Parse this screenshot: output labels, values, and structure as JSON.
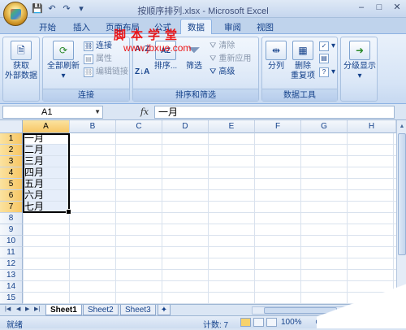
{
  "window": {
    "title": "按顺序排列.xlsx - Microsoft Excel",
    "qat": [
      "💾",
      "↶",
      "↷",
      "▾"
    ],
    "controls": [
      "–",
      "□",
      "✕"
    ]
  },
  "tabs": [
    {
      "label": "开始"
    },
    {
      "label": "插入"
    },
    {
      "label": "页面布局"
    },
    {
      "label": "公式"
    },
    {
      "label": "数据"
    },
    {
      "label": "审阅"
    },
    {
      "label": "视图"
    }
  ],
  "watermark": {
    "line1": "脚本学堂",
    "line2": "www.jbxue.com"
  },
  "ribbon": {
    "get_external_line1": "获取",
    "get_external_line2": "外部数据",
    "refresh_all": "全部刷新",
    "connections": "连接",
    "properties": "属性",
    "edit_links": "编辑链接",
    "group_connections": "连接",
    "sort": "排序...",
    "filter": "筛选",
    "clear": "清除",
    "reapply": "重新应用",
    "advanced": "高级",
    "group_sort_filter": "排序和筛选",
    "text_to_columns": "分列",
    "remove_dup_line1": "删除",
    "remove_dup_line2": "重复项",
    "group_data_tools": "数据工具",
    "outline": "分级显示"
  },
  "formula_bar": {
    "name_box": "A1",
    "fx": "fx",
    "value": "一月"
  },
  "grid": {
    "columns": [
      "A",
      "B",
      "C",
      "D",
      "E",
      "F",
      "G",
      "H"
    ],
    "rows": [
      "1",
      "2",
      "3",
      "4",
      "5",
      "6",
      "7",
      "8",
      "9",
      "10",
      "11",
      "12",
      "13",
      "14",
      "15"
    ],
    "column_a": [
      "一月",
      "二月",
      "三月",
      "四月",
      "五月",
      "六月",
      "七月"
    ]
  },
  "sheets": [
    "Sheet1",
    "Sheet2",
    "Sheet3"
  ],
  "status": {
    "ready": "就绪",
    "count": "计数: 7",
    "zoom": "100%"
  }
}
